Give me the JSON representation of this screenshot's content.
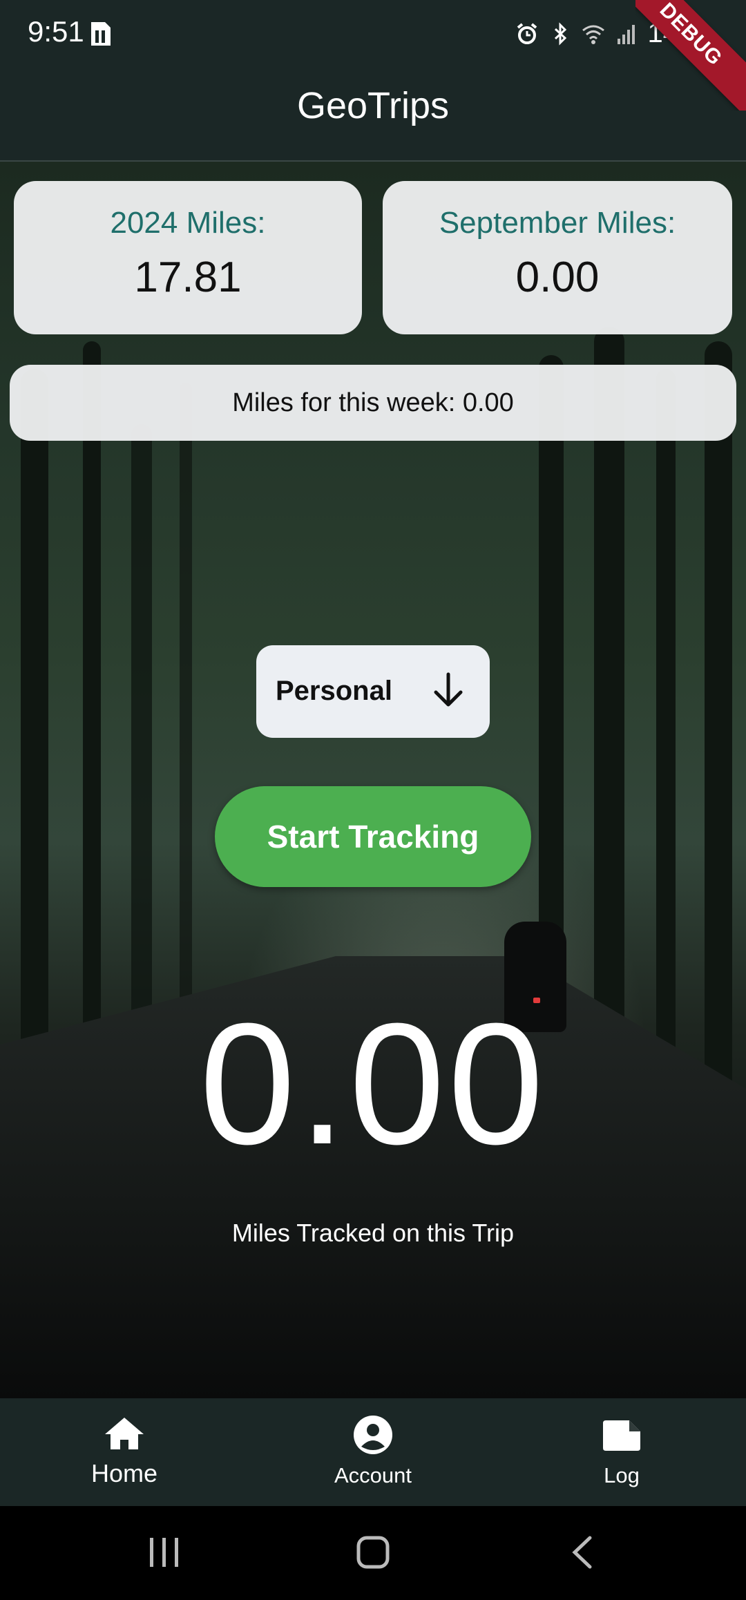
{
  "status_bar": {
    "time": "9:51",
    "battery": "14"
  },
  "app_bar": {
    "title": "GeoTrips",
    "debug_banner": "DEBUG"
  },
  "stats": {
    "year_label": "2024 Miles:",
    "year_value": "17.81",
    "month_label": "September Miles:",
    "month_value": "0.00",
    "week_text": "Miles for this week: 0.00"
  },
  "trip_type": {
    "selected": "Personal"
  },
  "tracking": {
    "button_label": "Start Tracking",
    "miles": "0.00",
    "miles_label": "Miles Tracked on this Trip"
  },
  "bottom_nav": {
    "items": [
      {
        "label": "Home",
        "icon": "home-icon"
      },
      {
        "label": "Account",
        "icon": "account-icon"
      },
      {
        "label": "Log",
        "icon": "log-icon"
      }
    ]
  },
  "colors": {
    "app_bar": "#1b2726",
    "accent_green": "#4caf50",
    "label_teal": "#1f6f6b",
    "debug_red": "#a3182a"
  }
}
